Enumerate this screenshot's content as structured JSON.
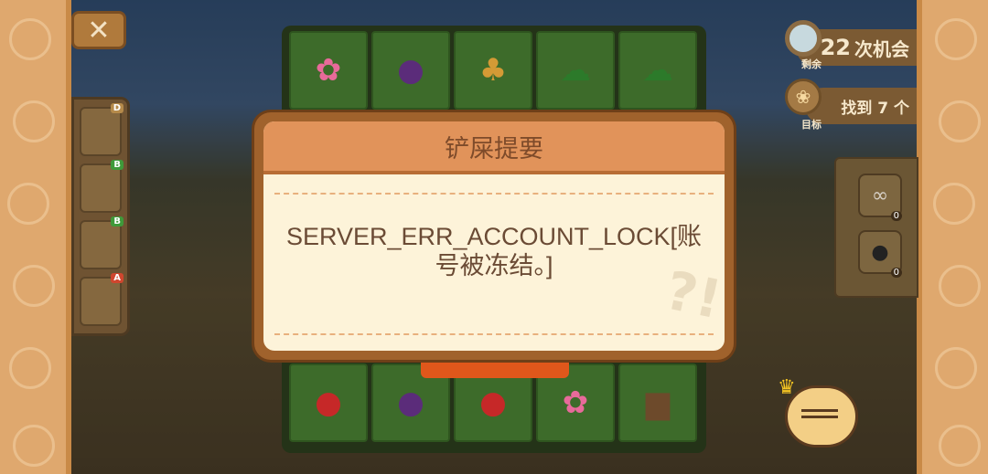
{
  "dialog": {
    "title": "铲屎提要",
    "message": "SERVER_ERR_ACCOUNT_LOCK[账号被冻结。]"
  },
  "hud": {
    "remaining_count": "22",
    "remaining_unit": "次机会",
    "remaining_label": "剩余",
    "target_text": "找到 7 个",
    "target_label": "目标"
  },
  "inventory": [
    {
      "icon": "banana-icon",
      "grade": "D",
      "grade_color": "#b58a4a"
    },
    {
      "icon": "mushroom-icon",
      "grade": "B",
      "grade_color": "#3f9a3a"
    },
    {
      "icon": "meat-icon",
      "grade": "B",
      "grade_color": "#3f9a3a"
    },
    {
      "icon": "bread-icon",
      "grade": "A",
      "grade_color": "#d0462e"
    }
  ],
  "tools": [
    {
      "icon": "glasses-icon",
      "count": "0"
    },
    {
      "icon": "bomb-icon",
      "count": "0"
    }
  ],
  "grid_top_row": [
    "flower-bush-icon",
    "balloon-icon",
    "mushroom-icon",
    "bush-icon",
    "bush-icon"
  ],
  "grid_bottom_row": [
    "apple-icon",
    "balloon-icon",
    "apple-icon",
    "flower-bush-icon",
    "stump-icon"
  ],
  "colors": {
    "dialog_header": "#e1935a",
    "dialog_body": "#fdf3d9",
    "accent_button": "#e0571b"
  }
}
